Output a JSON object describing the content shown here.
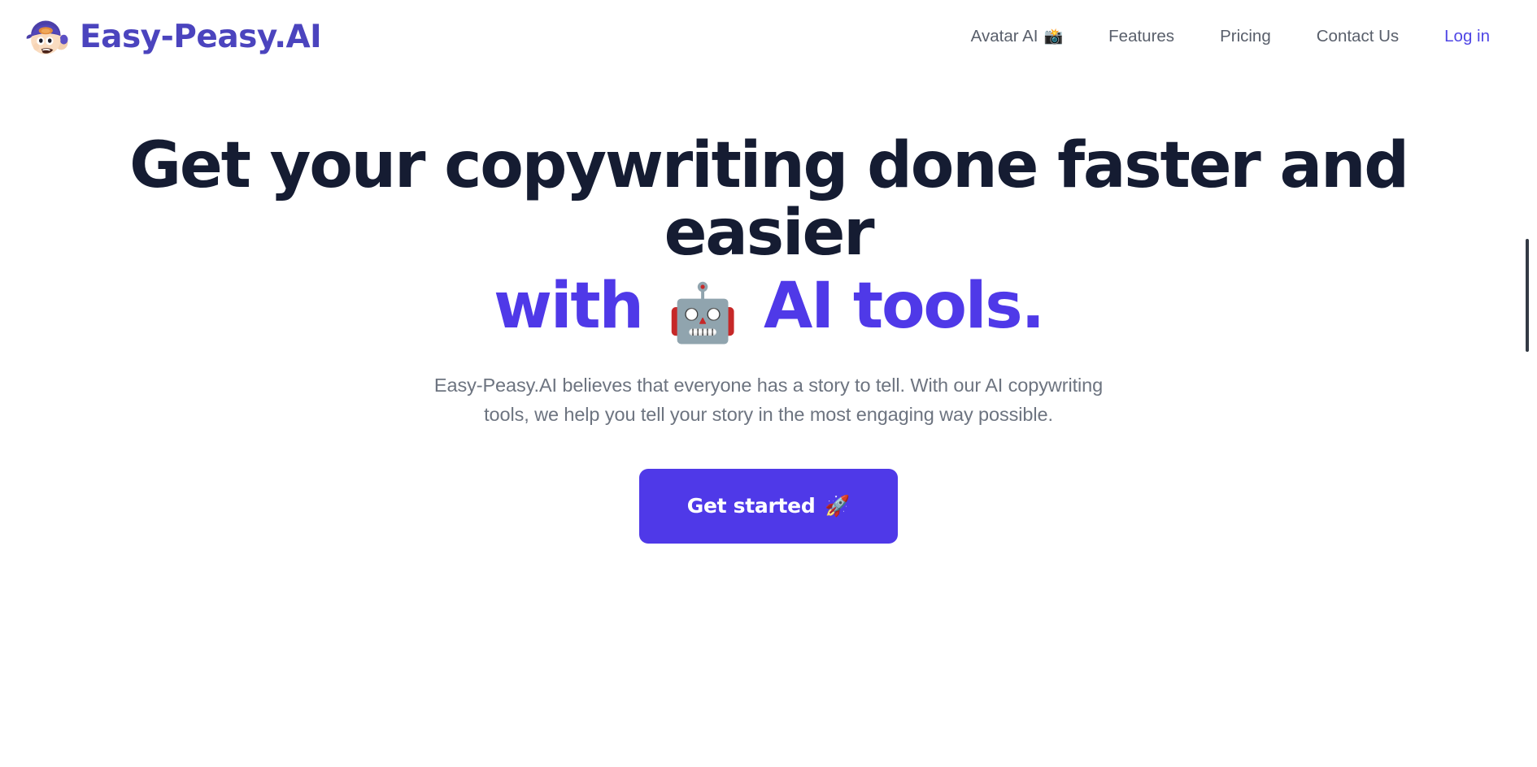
{
  "brand": {
    "name": "Easy-Peasy.AI",
    "mascot_icon": "boy-with-cap-mascot-icon",
    "wordmark_color": "#4B44BE"
  },
  "nav": {
    "items": [
      {
        "label": "Avatar AI",
        "emoji": "📸",
        "emoji_name": "camera-with-flash-icon",
        "style": "default"
      },
      {
        "label": "Features",
        "emoji": "",
        "emoji_name": "",
        "style": "default"
      },
      {
        "label": "Pricing",
        "emoji": "",
        "emoji_name": "",
        "style": "default"
      },
      {
        "label": "Contact Us",
        "emoji": "",
        "emoji_name": "",
        "style": "default"
      },
      {
        "label": "Log in",
        "emoji": "",
        "emoji_name": "",
        "style": "login"
      }
    ]
  },
  "hero": {
    "heading_line_1": "Get your copywriting done faster and",
    "heading_line_2": "easier",
    "accent_prefix": "with",
    "accent_emoji": "🤖",
    "accent_emoji_name": "robot-face-icon",
    "accent_suffix": "AI tools.",
    "subtitle": "Easy-Peasy.AI believes that everyone has a story to tell. With our AI copywriting tools, we help you tell your story in the most engaging way possible.",
    "cta_label": "Get started",
    "cta_emoji": "🚀",
    "cta_emoji_name": "rocket-icon"
  },
  "colors": {
    "accent_purple": "#4F39E8",
    "heading_navy": "#151C32",
    "body_gray": "#6d7480",
    "nav_gray": "#595f6b",
    "login_indigo": "#4F46E5",
    "background": "#ffffff",
    "scrollbar_thumb": "#333a45"
  }
}
